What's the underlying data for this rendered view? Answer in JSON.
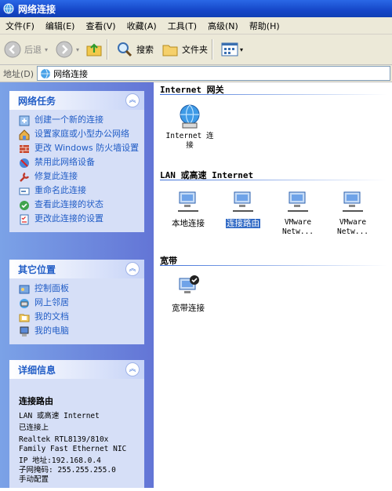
{
  "window": {
    "title": "网络连接"
  },
  "menu": [
    "文件(F)",
    "编辑(E)",
    "查看(V)",
    "收藏(A)",
    "工具(T)",
    "高级(N)",
    "帮助(H)"
  ],
  "toolbar": {
    "back": "后退",
    "search": "搜索",
    "folders": "文件夹"
  },
  "address": {
    "label": "地址(D)",
    "value": "网络连接"
  },
  "tasks_panel": {
    "title": "网络任务",
    "items": [
      "创建一个新的连接",
      "设置家庭或小型办公网络",
      "更改 Windows 防火墙设置",
      "禁用此网络设备",
      "修复此连接",
      "重命名此连接",
      "查看此连接的状态",
      "更改此连接的设置"
    ]
  },
  "places_panel": {
    "title": "其它位置",
    "items": [
      "控制面板",
      "网上邻居",
      "我的文档",
      "我的电脑"
    ]
  },
  "details_panel": {
    "title": "详细信息",
    "name": "连接路由",
    "lines": [
      "LAN 或高速 Internet",
      "已连接上",
      "Realtek RTL8139/810x Family Fast Ethernet NIC",
      "IP 地址:192.168.0.4",
      "子网掩码: 255.255.255.0",
      "手动配置"
    ]
  },
  "groups": {
    "internet": {
      "label": "Internet 网关",
      "items": [
        "Internet 连接"
      ]
    },
    "lan": {
      "label": "LAN 或高速 Internet",
      "items": [
        "本地连接",
        "连接路由",
        "VMware Netw...",
        "VMware Netw..."
      ]
    },
    "broadband": {
      "label": "宽带",
      "items": [
        "宽带连接"
      ]
    }
  },
  "colors": {
    "link": "#215dc6",
    "selection": "#316ac5",
    "titlebar": "#1546c8"
  }
}
